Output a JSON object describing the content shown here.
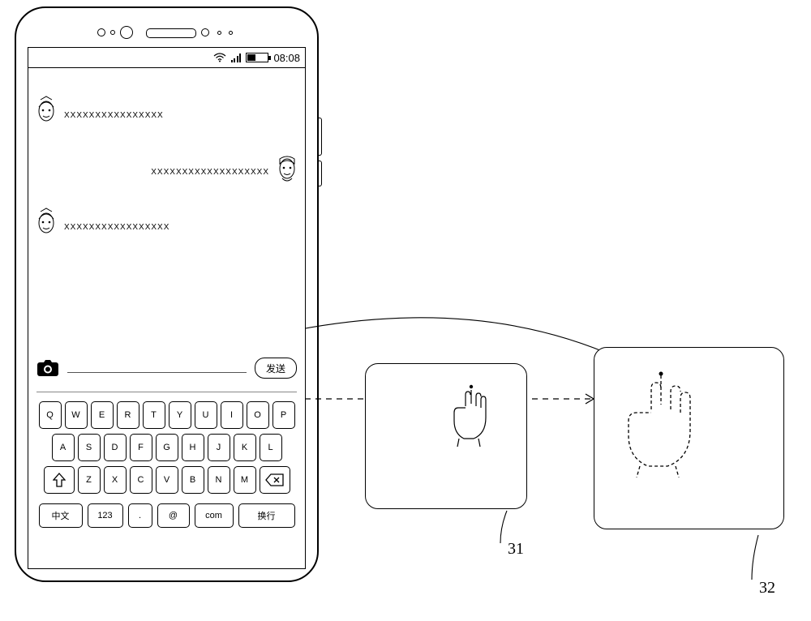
{
  "status": {
    "time": "08:08"
  },
  "chat": {
    "m1": "XXXXXXXXXXXXXXXX",
    "m2": "XXXXXXXXXXXXXXXXXXX",
    "m3": "XXXXXXXXXXXXXXXXX"
  },
  "inputbar": {
    "send": "发送"
  },
  "keys": {
    "row1": {
      "k0": "Q",
      "k1": "W",
      "k2": "E",
      "k3": "R",
      "k4": "T",
      "k5": "Y",
      "k6": "U",
      "k7": "I",
      "k8": "O",
      "k9": "P"
    },
    "row2": {
      "k0": "A",
      "k1": "S",
      "k2": "D",
      "k3": "F",
      "k4": "G",
      "k5": "H",
      "k6": "J",
      "k7": "K",
      "k8": "L"
    },
    "row3": {
      "k0": "Z",
      "k1": "X",
      "k2": "C",
      "k3": "V",
      "k4": "B",
      "k5": "N",
      "k6": "M"
    },
    "row4": {
      "cn": "中文",
      "num": "123",
      "dot": ".",
      "at": "@",
      "com": "com",
      "enter": "换行"
    }
  },
  "labels": {
    "pad1": "31",
    "pad2": "32"
  }
}
